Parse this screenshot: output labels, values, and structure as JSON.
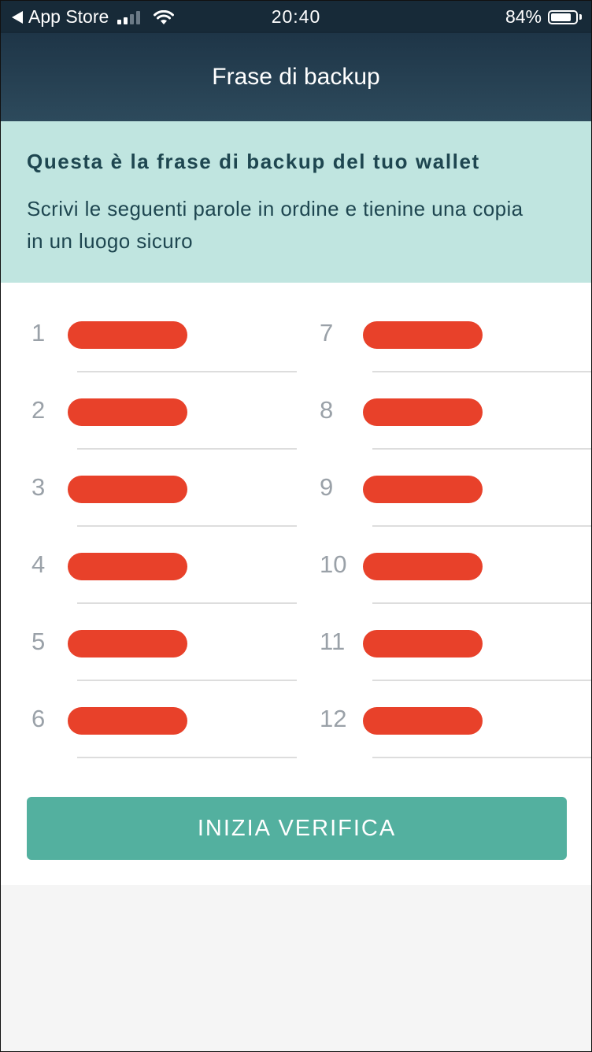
{
  "status_bar": {
    "back_app": "App Store",
    "time": "20:40",
    "battery_percent": "84%",
    "battery_level": 0.84,
    "signal_bars_active": 2,
    "signal_bars_total": 4
  },
  "nav": {
    "title": "Frase di backup"
  },
  "info": {
    "heading": "Questa è la frase di backup del tuo wallet",
    "text": "Scrivi le seguenti parole in ordine e tienine una copia in un luogo sicuro"
  },
  "words": {
    "left": [
      {
        "number": "1"
      },
      {
        "number": "2"
      },
      {
        "number": "3"
      },
      {
        "number": "4"
      },
      {
        "number": "5"
      },
      {
        "number": "6"
      }
    ],
    "right": [
      {
        "number": "7"
      },
      {
        "number": "8"
      },
      {
        "number": "9"
      },
      {
        "number": "10"
      },
      {
        "number": "11"
      },
      {
        "number": "12"
      }
    ],
    "redaction_color": "#e8412a"
  },
  "button": {
    "label": "INIZIA VERIFICA",
    "color": "#53b09f"
  },
  "colors": {
    "status_bar": "#172a38",
    "nav_bar": "#2d4a5c",
    "banner": "#c0e5e0",
    "banner_text": "#1e4650"
  }
}
